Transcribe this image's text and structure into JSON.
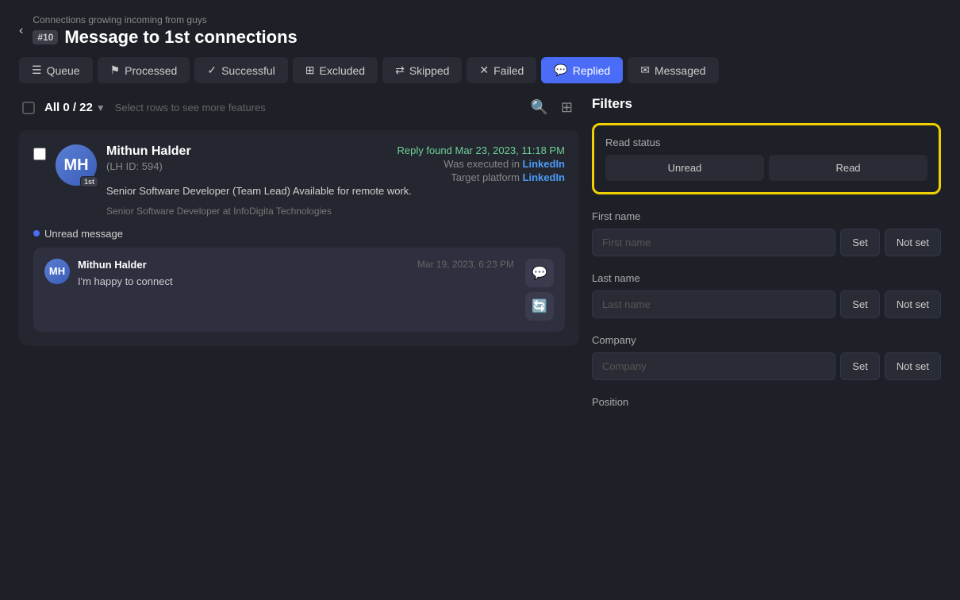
{
  "header": {
    "back_label": "‹",
    "subtitle": "Connections growing incoming from guys",
    "badge": "#10",
    "title": "Message to 1st connections"
  },
  "tabs": [
    {
      "id": "queue",
      "label": "Queue",
      "icon": "☰"
    },
    {
      "id": "processed",
      "label": "Processed",
      "icon": "⚑"
    },
    {
      "id": "successful",
      "label": "Successful",
      "icon": "✓"
    },
    {
      "id": "excluded",
      "label": "Excluded",
      "icon": "⊞"
    },
    {
      "id": "skipped",
      "label": "Skipped",
      "icon": "⇄"
    },
    {
      "id": "failed",
      "label": "Failed",
      "icon": "✕"
    },
    {
      "id": "replied",
      "label": "Replied",
      "icon": "💬",
      "active": true
    },
    {
      "id": "messaged",
      "label": "Messaged",
      "icon": "✉"
    }
  ],
  "toolbar": {
    "select_count": "All 0 / 22",
    "select_hint": "Select rows to see more features"
  },
  "contact": {
    "name": "Mithun Halder",
    "id_label": "(LH ID: 594)",
    "badge": "1st",
    "headline": "Senior Software Developer (Team Lead) Available for remote work.",
    "current_role": "Senior Software Developer at InfoDigita Technologies",
    "reply_found": "Reply found Mar 23, 2023, 11:18 PM",
    "executed_label": "Was executed in",
    "platform": "LinkedIn",
    "target_label": "Target platform",
    "target_platform": "LinkedIn",
    "unread_label": "Unread message",
    "message": {
      "sender": "Mithun Halder",
      "time": "Mar 19, 2023, 6:23 PM",
      "text": "I'm happy to connect"
    }
  },
  "filters": {
    "header": "Filters",
    "read_status": {
      "label": "Read status",
      "options": [
        "Unread",
        "Read"
      ]
    },
    "first_name": {
      "label": "First name",
      "placeholder": "First name",
      "set_label": "Set",
      "not_set_label": "Not set"
    },
    "last_name": {
      "label": "Last name",
      "placeholder": "Last name",
      "set_label": "Set",
      "not_set_label": "Not set"
    },
    "company": {
      "label": "Company",
      "placeholder": "Company",
      "set_label": "Set",
      "not_set_label": "Not set"
    },
    "position": {
      "label": "Position"
    }
  }
}
